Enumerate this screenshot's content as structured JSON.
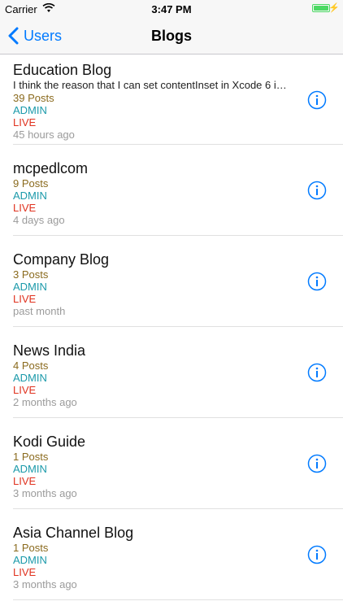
{
  "status_bar": {
    "carrier": "Carrier",
    "time": "3:47 PM"
  },
  "nav": {
    "back_label": "Users",
    "title": "Blogs"
  },
  "blogs": [
    {
      "name": "Education Blog",
      "description": "I think the reason that I can set contentInset in Xcode 6 is…",
      "posts": "39 Posts",
      "role": "ADMIN",
      "status": "LIVE",
      "updated": "45 hours ago"
    },
    {
      "name": "mcpedlcom",
      "posts": "9 Posts",
      "role": "ADMIN",
      "status": "LIVE",
      "updated": "4 days ago"
    },
    {
      "name": "Company Blog",
      "posts": "3 Posts",
      "role": "ADMIN",
      "status": "LIVE",
      "updated": "past month"
    },
    {
      "name": "News India",
      "posts": "4 Posts",
      "role": "ADMIN",
      "status": "LIVE",
      "updated": "2 months ago"
    },
    {
      "name": "Kodi Guide",
      "posts": "1 Posts",
      "role": "ADMIN",
      "status": "LIVE",
      "updated": "3 months ago"
    },
    {
      "name": "Asia Channel Blog",
      "posts": "1 Posts",
      "role": "ADMIN",
      "status": "LIVE",
      "updated": "3 months ago"
    }
  ],
  "colors": {
    "tint": "#007aff",
    "posts": "#8a6a1d",
    "role": "#1b9aaa",
    "status": "#e0321f",
    "time": "#9b9b9b",
    "battery": "#4cd964"
  }
}
